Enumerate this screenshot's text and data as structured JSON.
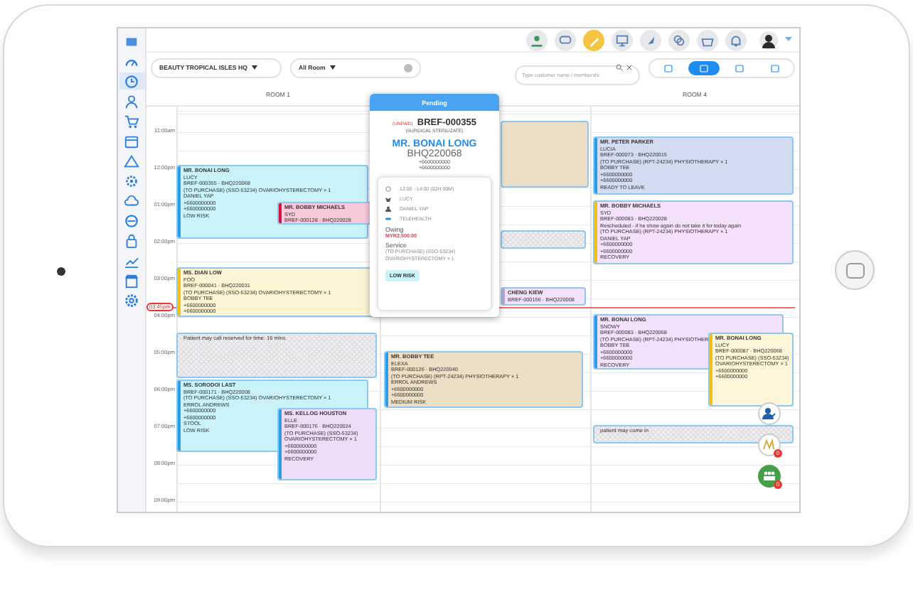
{
  "sidebar": {
    "items": [
      {
        "selected": false
      },
      {
        "selected": false
      },
      {
        "selected": true
      },
      {
        "selected": false
      },
      {
        "selected": false
      },
      {
        "selected": false
      },
      {
        "selected": false
      },
      {
        "selected": false
      },
      {
        "selected": false
      },
      {
        "selected": false
      },
      {
        "selected": false
      },
      {
        "selected": false
      },
      {
        "selected": false
      },
      {
        "selected": false
      }
    ]
  },
  "top_bar": {
    "icons": [
      {
        "selected": false
      },
      {
        "selected": false
      },
      {
        "selected": true
      },
      {
        "selected": false
      },
      {
        "selected": false
      },
      {
        "selected": false
      },
      {
        "selected": false
      },
      {
        "selected": false
      }
    ]
  },
  "filters": {
    "location": "BEAUTY TROPICAL ISLES HQ",
    "room": "All Room",
    "search": {
      "placeholder": "Type customer name / membershi"
    },
    "views": [
      {
        "selected": false
      },
      {
        "selected": true
      },
      {
        "selected": false
      },
      {
        "selected": false
      }
    ]
  },
  "room_headers": [
    "ROOM 1",
    "ROOM 4"
  ],
  "times": [
    "11:00am",
    "12:00pm",
    "01:00pm",
    "02:00pm",
    "03:00pm",
    "04:00pm",
    "05:00pm",
    "06:00pm",
    "07:00pm",
    "08:00pm",
    "09:00pm"
  ],
  "current_time": "03:45pm",
  "appointments": [
    {
      "kind": "booking",
      "color": "#c9f3f8",
      "stripe": {
        "color": "#2a9de8"
      },
      "name": "MR. BONAI LONG",
      "lines": [
        "LUCY",
        "BREF-000355 · BHQ220068",
        "(TO PURCHASE) (SSO-53234) OVARIOHYSTERECTOMY × 1",
        "DANIEL YAP",
        "+6600000000",
        "+6600000000",
        "LOW RISK"
      ]
    },
    {
      "kind": "booking",
      "color": "#f9c9dc",
      "stripe": {
        "color": "#d5133a"
      },
      "name": "MR. BOBBY MICHAELS",
      "lines": [
        "SYD",
        "BREF-000128 · BHQ220028"
      ]
    },
    {
      "kind": "booking",
      "color": "#fdf4d4",
      "stripe": {
        "color": "#f5c016"
      },
      "name": "MS. DIAN LOW",
      "lines": [
        "FOO",
        "BREF-000041 · BHQ220031",
        "(TO PURCHASE) (SSO-53234) OVARIOHYSTERECTOMY × 1",
        "BOBBY TEE",
        "+6600000000",
        "+6600000000"
      ]
    },
    {
      "kind": "block",
      "color": "#f0eef3",
      "name": "Patient may call reserved for time: 16 mins"
    },
    {
      "kind": "booking",
      "color": "#c9f3f8",
      "stripe": {
        "color": "#2a9de8"
      },
      "name": "MS. SORODOI LAST",
      "lines": [
        "BREF-000171 · BHQ220008",
        "(TO PURCHASE) (SSO-53234) OVARIOHYSTERECTOMY × 1",
        "ERROL ANDREWS",
        "+6600000000",
        "+6600000000",
        "STOOL",
        "LOW RISK"
      ]
    },
    {
      "kind": "booking",
      "color": "#efdcf7",
      "stripe": {
        "color": "#2a9de8"
      },
      "name": "MS. KELLOG HOUSTON",
      "lines": [
        "ELLE",
        "BREF-000176 · BHQ220024",
        "(TO PURCHASE) (SSO-53234)",
        "OVARIOHYSTERECTOMY × 1",
        "+6600000000",
        "+6600000000",
        "RECOVERY"
      ]
    },
    {
      "kind": "booking",
      "color": "#ecdfc6"
    },
    {
      "kind": "block",
      "color": "#f0eef3"
    },
    {
      "kind": "booking",
      "color": "#f3e1fb",
      "stripe": {
        "color": "#b9a8cc"
      },
      "name": "CHENG KIEW",
      "lines": [
        "BREF-000156 · BHQ220008"
      ]
    },
    {
      "kind": "booking",
      "color": "#ecdfc6",
      "stripe": {
        "color": "#2a9de8"
      },
      "name": "MR. BOBBY TEE",
      "lines": [
        "ELEXA",
        "BREF-000126 · BHQ220040",
        "(TO PURCHASE) (RPT-24234) PHYSIOTHERAPY × 1",
        "ERROL ANDREWS",
        "+6600000000",
        "+6600000000",
        "MEDIUM RISK"
      ]
    },
    {
      "kind": "booking",
      "color": "#d3dcf0",
      "stripe": {
        "color": "#2a9de8"
      },
      "name": "MR. PETER PARKER",
      "lines": [
        "LUCIA",
        "BREF-000073 · BHQ220015",
        "(TO PURCHASE) (RPT-24234) PHYSIOTHERAPY × 1",
        "BOBBY TEE",
        "+6600000000",
        "+6600000000",
        "READY TO LEAVE"
      ]
    },
    {
      "kind": "booking",
      "color": "#f5e1fb",
      "stripe": {
        "color": "#f5c016"
      },
      "name": "MR. BOBBY MICHAELS",
      "lines": [
        "SYD",
        "BREF-000083 · BHQ220028",
        "Rescheduled - if he show again do not take it for today again",
        "(TO PURCHASE) (RPT-24234) PHYSIOTHERAPY × 1",
        "DANIEL YAP",
        "+6600000000",
        "+6600000000",
        "RECOVERY"
      ]
    },
    {
      "kind": "booking",
      "color": "#f3e1fb",
      "stripe": {
        "color": "#2a9de8"
      },
      "name": "MR. BONAI LONG",
      "lines": [
        "SNOWY",
        "BREF-000083 · BHQ220068",
        "(TO PURCHASE) (RPT-24234) PHYSIOTHER",
        "BOBBY TEE",
        "+6600000000",
        "+6600000000",
        "RECOVERY"
      ]
    },
    {
      "kind": "booking",
      "color": "#fdf6d8",
      "stripe": {
        "color": "#f5c016"
      },
      "name": "MR. BONAI LONG",
      "lines": [
        "LUCY",
        "BREF-000087 · BHQ220068",
        "(TO PURCHASE) (SSO-53234)",
        "OVARIOHYSTERECTOMY × 1",
        "+6600000000",
        "+6600000000"
      ]
    },
    {
      "kind": "block",
      "color": "#f0eef3",
      "name": "patient may come in"
    }
  ],
  "popup": {
    "status": "Pending",
    "payment": "(UNPAID)",
    "booking_ref": "BREF-000355",
    "procedure": "(SURGICAL STERILIZATE)",
    "customer": "MR. BONAI LONG",
    "customer_id": "BHQ220068",
    "phones": [
      "+6600000000",
      "+6600000000"
    ],
    "details": [
      {
        "kind": "time",
        "text": "12:00 - 14:00 (02H 00M)"
      },
      {
        "kind": "pet",
        "text": "LUCY"
      },
      {
        "kind": "staff",
        "text": "DANIEL YAP"
      },
      {
        "kind": "room",
        "text": "TELEHEALTH"
      }
    ],
    "owing_label": "Owing",
    "owing": "MYR2,500.00",
    "service_label": "Service",
    "service": [
      "(TO PURCHASE) (SSO-53234)",
      "OVARIOHYSTERECTOMY × 1"
    ],
    "risk": "LOW RISK"
  },
  "fabs": [
    {
      "kind": "staff"
    },
    {
      "kind": "memo",
      "badge": "0"
    },
    {
      "kind": "group",
      "badge": "0"
    }
  ]
}
